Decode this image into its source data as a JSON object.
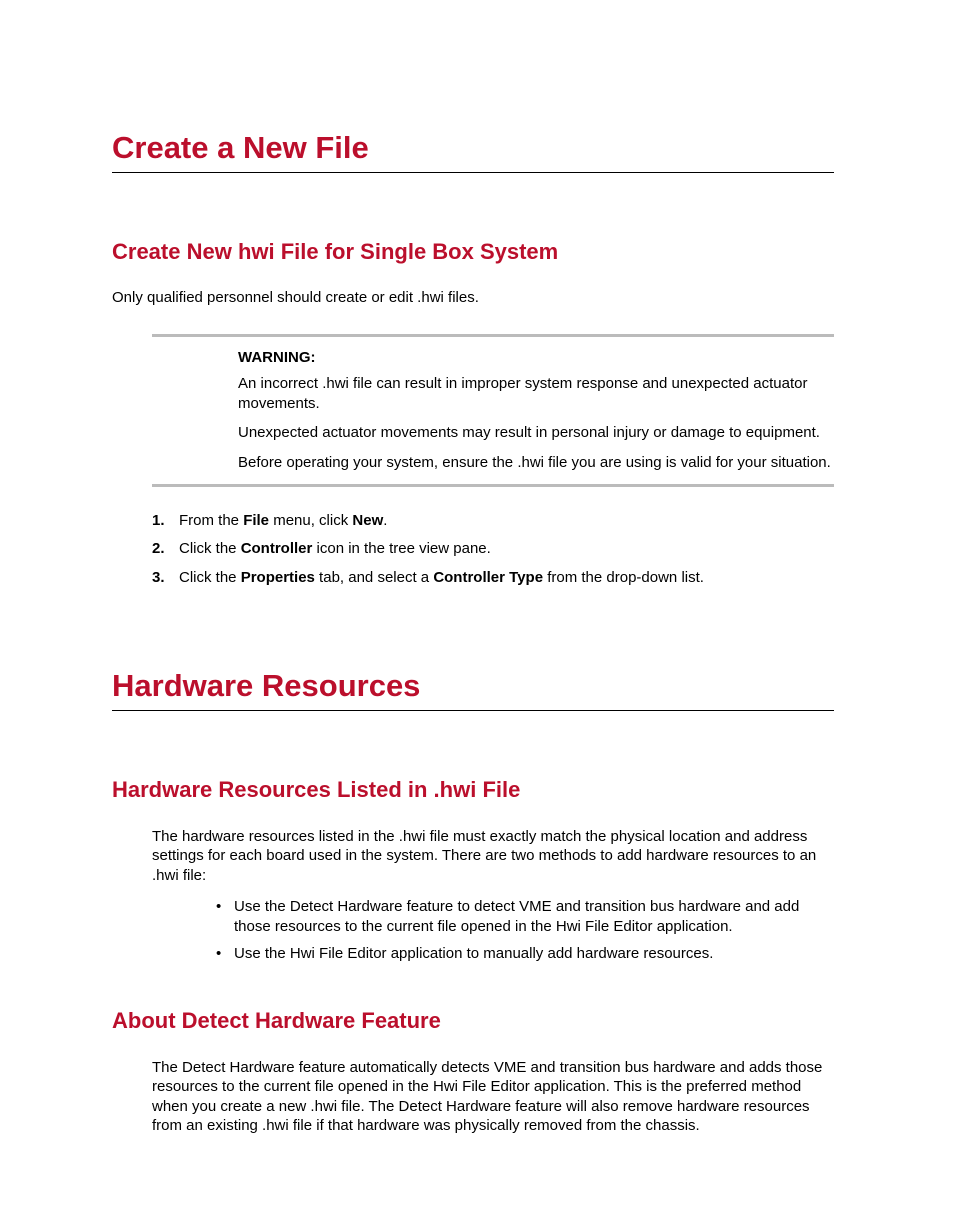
{
  "h1_createFile": "Create a New File",
  "h2_singleBox": "Create New hwi File for Single Box System",
  "intro_singleBox": "Only qualified personnel should create or edit .hwi files.",
  "warning": {
    "label": "WARNING:",
    "p1": "An incorrect .hwi file can result in improper system response and unexpected actuator movements.",
    "p2": "Unexpected actuator movements may result in personal injury or damage to equipment.",
    "p3": "Before operating your system, ensure the .hwi file you are using is valid for your situation."
  },
  "steps": {
    "s1_a": "From the ",
    "s1_b": "File",
    "s1_c": " menu, click ",
    "s1_d": "New",
    "s1_e": ".",
    "s2_a": "Click the ",
    "s2_b": "Controller",
    "s2_c": " icon in the tree view pane.",
    "s3_a": "Click the ",
    "s3_b": "Properties",
    "s3_c": " tab, and select a ",
    "s3_d": "Controller Type",
    "s3_e": " from the drop-down list."
  },
  "h1_hardware": "Hardware Resources",
  "h2_listed": "Hardware Resources Listed in .hwi File",
  "listed_intro": "The hardware resources listed in the .hwi file must exactly match the physical location and address settings for each board used in the system. There are two methods to add hardware resources to an .hwi file:",
  "listed_b1": "Use the Detect Hardware feature to detect VME and transition bus hardware and add those resources to the current file opened in the Hwi File Editor application.",
  "listed_b2": "Use the Hwi File Editor application to manually add hardware resources.",
  "h2_detect": "About Detect Hardware Feature",
  "detect_p": "The Detect Hardware feature automatically detects VME and transition bus hardware and adds those resources to the current file opened in the Hwi File Editor application. This is the preferred method when you create a new .hwi file. The Detect Hardware feature will also remove hardware resources from an existing .hwi file if that hardware was physically removed from the chassis."
}
